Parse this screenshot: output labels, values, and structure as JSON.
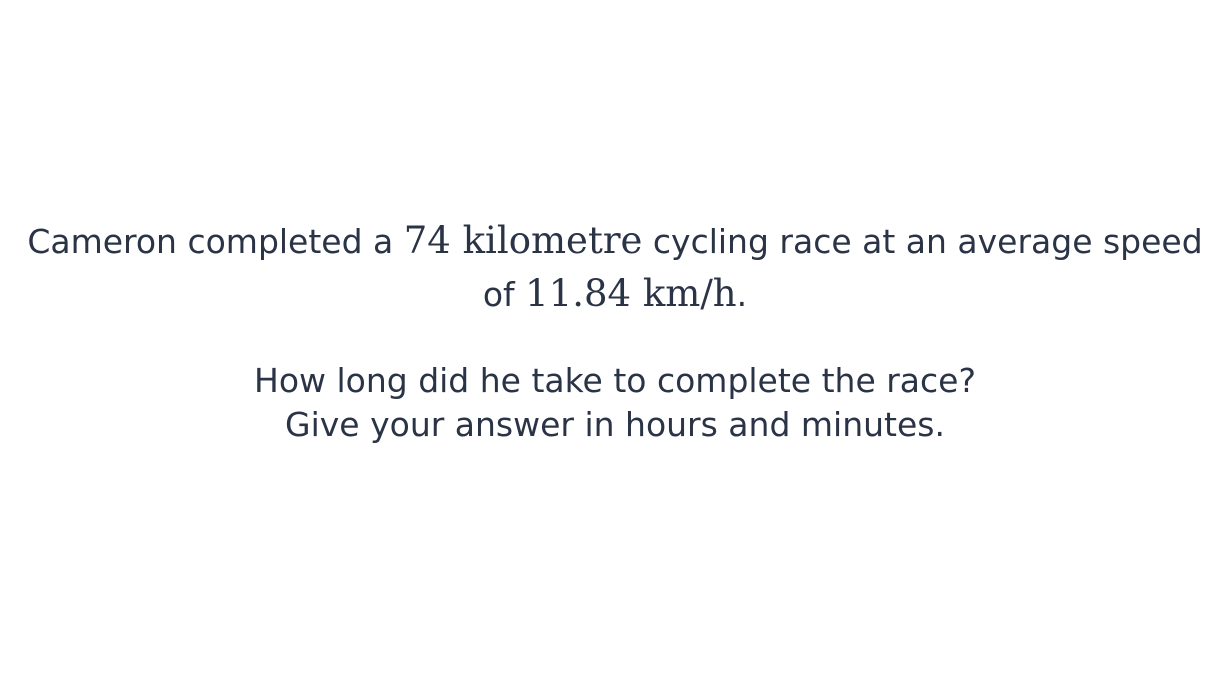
{
  "problem": {
    "line1": {
      "t1": "Cameron completed a ",
      "m1": "74 kilometre",
      "t2": " cycling race at an average speed"
    },
    "line2": {
      "t1": "of ",
      "m1": "11.84 km/h",
      "t2": "."
    },
    "question1": "How long did he take to complete the race?",
    "question2": "Give your answer in hours and minutes."
  }
}
